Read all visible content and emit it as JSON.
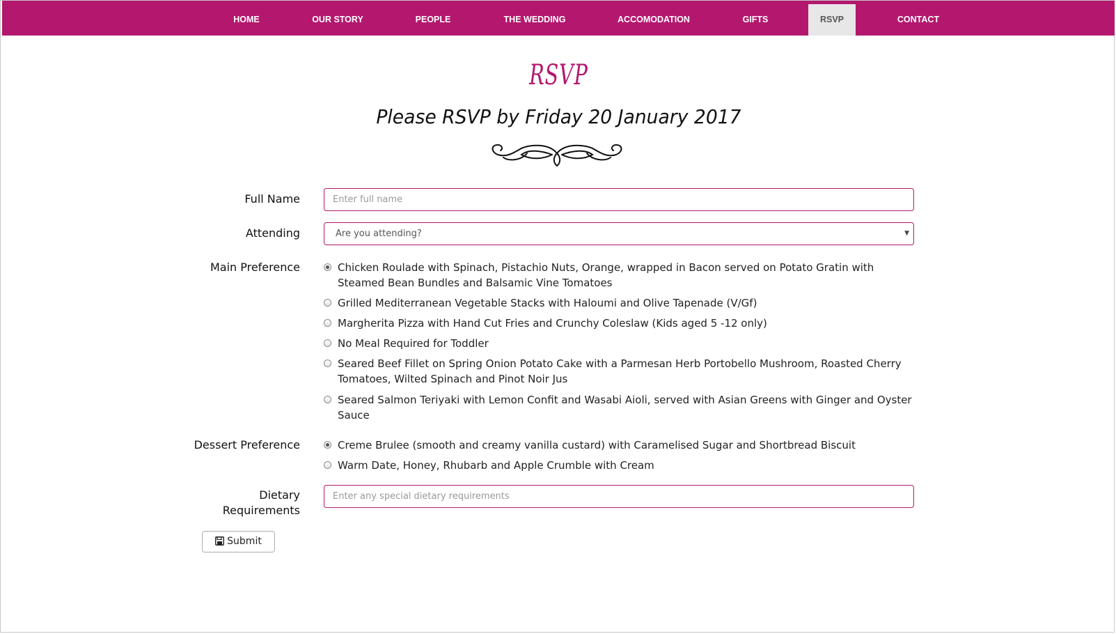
{
  "nav": {
    "items": [
      {
        "label": "HOME",
        "active": false
      },
      {
        "label": "OUR STORY",
        "active": false
      },
      {
        "label": "PEOPLE",
        "active": false
      },
      {
        "label": "THE WEDDING",
        "active": false
      },
      {
        "label": "ACCOMODATION",
        "active": false
      },
      {
        "label": "GIFTS",
        "active": false
      },
      {
        "label": "RSVP",
        "active": true
      },
      {
        "label": "CONTACT",
        "active": false
      }
    ]
  },
  "page": {
    "title": "RSVP",
    "subtitle": "Please RSVP by Friday 20 January 2017"
  },
  "form": {
    "full_name": {
      "label": "Full Name",
      "placeholder": "Enter full name",
      "value": ""
    },
    "attending": {
      "label": "Attending",
      "selected": "Are you attending?"
    },
    "main_preference": {
      "label": "Main Preference",
      "options": [
        {
          "text": "Chicken Roulade with Spinach, Pistachio Nuts, Orange, wrapped in Bacon served on Potato Gratin with Steamed Bean Bundles and Balsamic Vine Tomatoes",
          "checked": true
        },
        {
          "text": "Grilled Mediterranean Vegetable Stacks with Haloumi and Olive Tapenade (V/Gf)",
          "checked": false
        },
        {
          "text": "Margherita Pizza with Hand Cut Fries and Crunchy Coleslaw (Kids aged 5 -12 only)",
          "checked": false
        },
        {
          "text": "No Meal Required for Toddler",
          "checked": false
        },
        {
          "text": "Seared Beef Fillet on Spring Onion Potato Cake with a Parmesan Herb Portobello Mushroom, Roasted Cherry Tomatoes, Wilted Spinach and Pinot Noir Jus",
          "checked": false
        },
        {
          "text": "Seared Salmon Teriyaki with Lemon Confit and Wasabi Aioli, served with Asian Greens with Ginger and Oyster Sauce",
          "checked": false
        }
      ]
    },
    "dessert_preference": {
      "label": "Dessert Preference",
      "options": [
        {
          "text": "Creme Brulee (smooth and creamy vanilla custard) with Caramelised Sugar and Shortbread Biscuit",
          "checked": true
        },
        {
          "text": "Warm Date, Honey, Rhubarb and Apple Crumble with Cream",
          "checked": false
        }
      ]
    },
    "dietary": {
      "label_line1": "Dietary",
      "label_line2": "Requirements",
      "placeholder": "Enter any special dietary requirements",
      "value": ""
    },
    "submit_label": "Submit",
    "submit_icon": "save-icon"
  },
  "colors": {
    "brand": "#b3186e",
    "nav_active_bg": "#e7e7e7",
    "nav_active_text": "#555555"
  }
}
